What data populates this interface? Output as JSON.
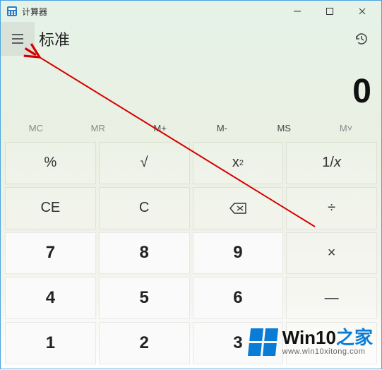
{
  "window": {
    "title": "计算器"
  },
  "header": {
    "mode": "标准"
  },
  "display": {
    "value": "0"
  },
  "memory": {
    "mc": "MC",
    "mr": "MR",
    "mplus": "M+",
    "mminus": "M-",
    "ms": "MS",
    "mlist": "M˅"
  },
  "buttons": {
    "percent": "%",
    "sqrt": "√",
    "square": "x",
    "square_sup": "2",
    "recip_top": "1",
    "recip_bot": "x",
    "ce": "CE",
    "c": "C",
    "divide": "÷",
    "n7": "7",
    "n8": "8",
    "n9": "9",
    "times": "×",
    "n4": "4",
    "n5": "5",
    "n6": "6",
    "minus": "—",
    "n1": "1",
    "n2": "2",
    "n3": "3"
  },
  "watermark": {
    "main_a": "Win10",
    "main_b": "之家",
    "sub": "www.win10xitong.com"
  }
}
